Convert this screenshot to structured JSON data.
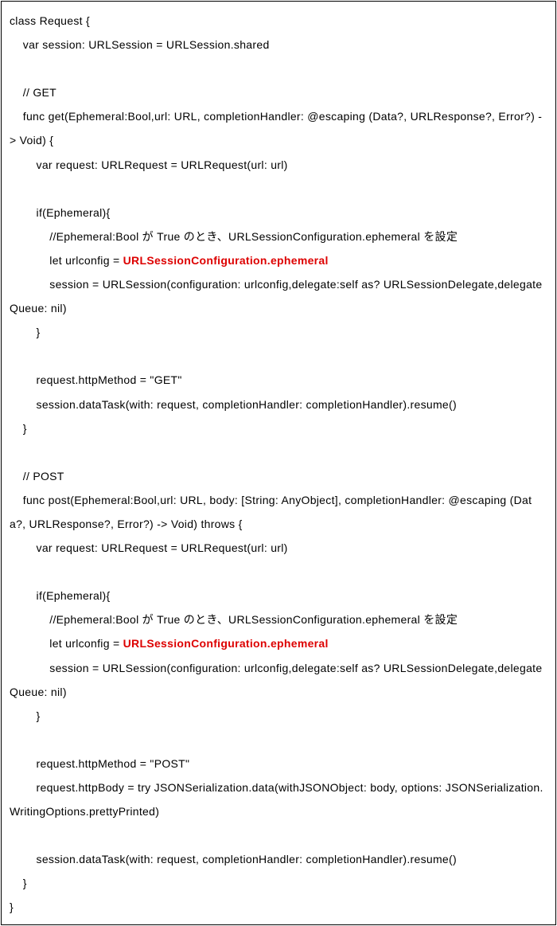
{
  "code": {
    "lines": [
      {
        "text": "class Request {",
        "indent": 0
      },
      {
        "text": "var session: URLSession = URLSession.shared",
        "indent": 1
      },
      {
        "text": "",
        "indent": 0
      },
      {
        "text": "// GET",
        "indent": 1
      },
      {
        "text": "func get(Ephemeral:Bool,url: URL, completionHandler: @escaping (Data?, URLResponse?, Error?) -> Void) {",
        "indent": 1,
        "wrapPrefix": ""
      },
      {
        "text": "var request: URLRequest = URLRequest(url: url)",
        "indent": 2
      },
      {
        "text": "",
        "indent": 0
      },
      {
        "text": "if(Ephemeral){",
        "indent": 2
      },
      {
        "text": "//Ephemeral:Bool が True のとき、URLSessionConfiguration.ephemeral を設定",
        "indent": 3
      },
      {
        "text": "let urlconfig = ",
        "indent": 3,
        "highlight": "URLSessionConfiguration.ephemeral"
      },
      {
        "text": "session = URLSession(configuration: urlconfig,delegate:self as? URLSessionDelegate,delegateQueue: nil)",
        "indent": 3
      },
      {
        "text": "}",
        "indent": 2
      },
      {
        "text": "",
        "indent": 0
      },
      {
        "text": "request.httpMethod = \"GET\"",
        "indent": 2
      },
      {
        "text": "session.dataTask(with: request, completionHandler: completionHandler).resume()",
        "indent": 2
      },
      {
        "text": "}",
        "indent": 1
      },
      {
        "text": "",
        "indent": 0
      },
      {
        "text": "// POST",
        "indent": 1
      },
      {
        "text": "func post(Ephemeral:Bool,url: URL, body: [String: AnyObject], completionHandler: @escaping (Data?, URLResponse?, Error?) -> Void) throws {",
        "indent": 1
      },
      {
        "text": "var request: URLRequest = URLRequest(url: url)",
        "indent": 2
      },
      {
        "text": "",
        "indent": 0
      },
      {
        "text": "if(Ephemeral){",
        "indent": 2
      },
      {
        "text": "//Ephemeral:Bool が True のとき、URLSessionConfiguration.ephemeral を設定",
        "indent": 3
      },
      {
        "text": "let urlconfig = ",
        "indent": 3,
        "highlight": "URLSessionConfiguration.ephemeral"
      },
      {
        "text": "session = URLSession(configuration: urlconfig,delegate:self as? URLSessionDelegate,delegateQueue: nil)",
        "indent": 3
      },
      {
        "text": "}",
        "indent": 2
      },
      {
        "text": "",
        "indent": 0
      },
      {
        "text": "request.httpMethod = \"POST\"",
        "indent": 2
      },
      {
        "text": "request.httpBody = try JSONSerialization.data(withJSONObject: body, options: JSONSerialization.WritingOptions.prettyPrinted)",
        "indent": 2
      },
      {
        "text": "",
        "indent": 0
      },
      {
        "text": "session.dataTask(with: request, completionHandler: completionHandler).resume()",
        "indent": 2
      },
      {
        "text": "}",
        "indent": 1
      },
      {
        "text": "}",
        "indent": 0
      }
    ]
  }
}
